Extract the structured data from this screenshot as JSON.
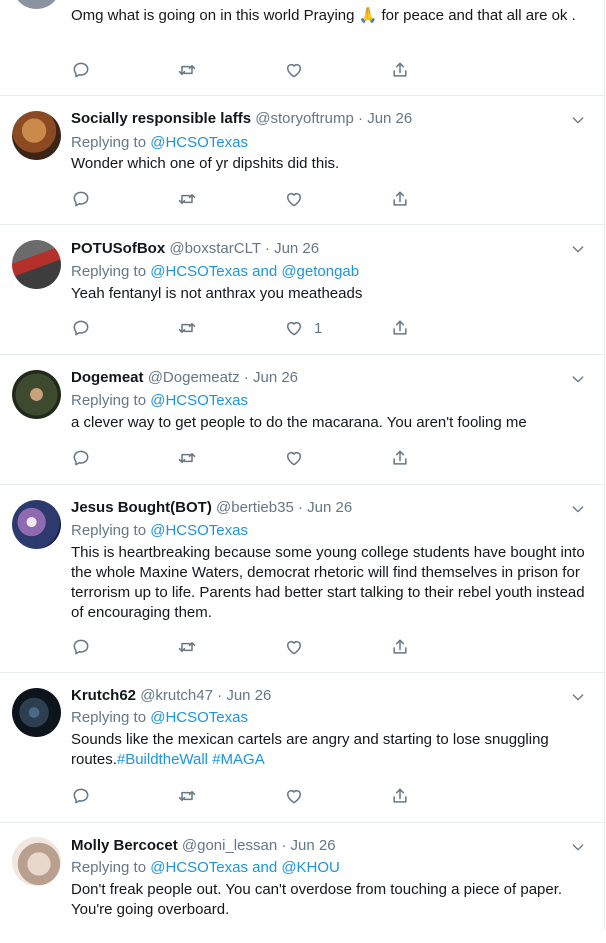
{
  "tweets": [
    {
      "id": "t0",
      "text": "Omg what is going on in this world Praying 🙏 for peace and that all are ok .",
      "like_count": ""
    },
    {
      "id": "t1",
      "name": "Socially responsible laffs",
      "handle": "@storyoftrump",
      "dot": "·",
      "time": "Jun 26",
      "replying_prefix": "Replying to",
      "mentions": "@HCSOTexas",
      "text": "Wonder which one of yr dipshits did this.",
      "like_count": ""
    },
    {
      "id": "t2",
      "name": "POTUSofBox",
      "handle": "@boxstarCLT",
      "dot": "·",
      "time": "Jun 26",
      "replying_prefix": "Replying to",
      "mentions": "@HCSOTexas and @getongab",
      "text": "Yeah fentanyl is not anthrax you meatheads",
      "like_count": "1"
    },
    {
      "id": "t3",
      "name": "Dogemeat",
      "handle": "@Dogemeatz",
      "dot": "·",
      "time": "Jun 26",
      "replying_prefix": "Replying to",
      "mentions": "@HCSOTexas",
      "text": "a clever way to get people to do the macarana. You aren't fooling me",
      "like_count": ""
    },
    {
      "id": "t4",
      "name": "Jesus Bought(BOT)",
      "handle": "@bertieb35",
      "dot": "·",
      "time": "Jun 26",
      "replying_prefix": "Replying to",
      "mentions": "@HCSOTexas",
      "text": "This is heartbreaking because some young college students have bought into the whole Maxine Waters, democrat rhetoric will find themselves in prison for terrorism up to life.  Parents had better start talking to their rebel youth instead of encouraging them.",
      "like_count": ""
    },
    {
      "id": "t5",
      "name": "Krutch62",
      "handle": "@krutch47",
      "dot": "·",
      "time": "Jun 26",
      "replying_prefix": "Replying to",
      "mentions": "@HCSOTexas",
      "text_plain": "Sounds like the mexican cartels are angry and starting to lose snuggling routes.",
      "hashtag1": "#BuildtheWall",
      "hashtag2": "#MAGA",
      "like_count": ""
    },
    {
      "id": "t6",
      "name": "Molly Bercocet",
      "handle": "@goni_lessan",
      "dot": "·",
      "time": "Jun 26",
      "replying_prefix": "Replying to",
      "mentions": "@HCSOTexas and @KHOU",
      "text": "Don't freak people out. You can't overdose from touching a piece of paper. You're going overboard."
    }
  ],
  "icons": {
    "reply": "reply-icon",
    "retweet": "retweet-icon",
    "like": "heart-icon",
    "share": "share-icon",
    "caret": "chevron-down-icon"
  },
  "colors": {
    "link": "#1b95e0",
    "secondary": "#657786",
    "divider": "#e6ecf0"
  }
}
